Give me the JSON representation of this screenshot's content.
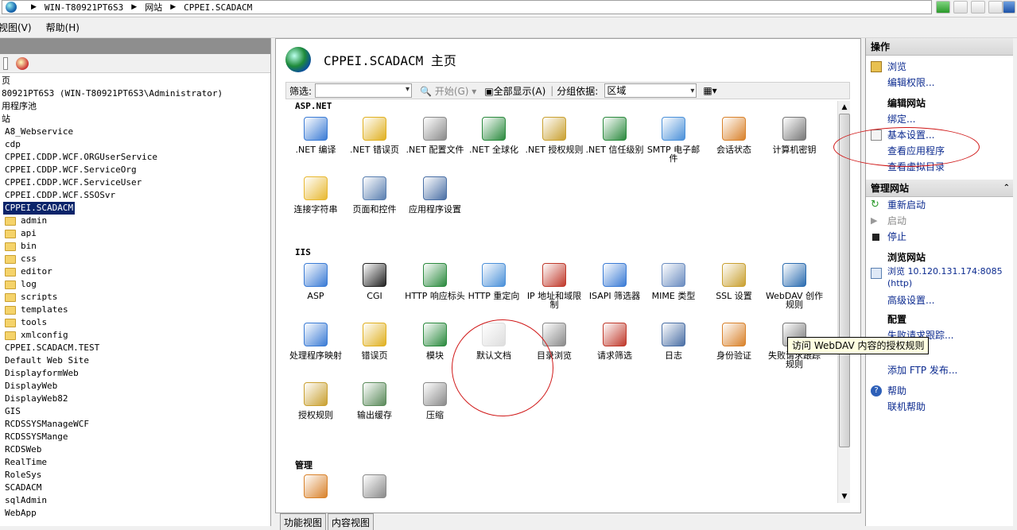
{
  "address": {
    "crumbs": [
      "WIN-T80921PT6S3",
      "网站",
      "CPPEI.SCADACM"
    ]
  },
  "menu": {
    "view": "视图(V)",
    "help": "帮助(H)"
  },
  "tree": {
    "items": [
      {
        "label": "页",
        "level": 0
      },
      {
        "label": "80921PT6S3 (WIN-T80921PT6S3\\Administrator)",
        "level": 0
      },
      {
        "label": "用程序池",
        "level": 0
      },
      {
        "label": "站",
        "level": 0
      },
      {
        "label": "A8_Webservice",
        "level": 1
      },
      {
        "label": "cdp",
        "level": 1
      },
      {
        "label": "CPPEI.CDDP.WCF.ORGUserService",
        "level": 1
      },
      {
        "label": "CPPEI.CDDP.WCF.ServiceOrg",
        "level": 1
      },
      {
        "label": "CPPEI.CDDP.WCF.ServiceUser",
        "level": 1
      },
      {
        "label": "CPPEI.CDDP.WCF.SSOSvr",
        "level": 1
      },
      {
        "label": "CPPEI.SCADACM",
        "level": 1,
        "selected": true
      },
      {
        "label": "admin",
        "level": 2
      },
      {
        "label": "api",
        "level": 2
      },
      {
        "label": "bin",
        "level": 2
      },
      {
        "label": "css",
        "level": 2
      },
      {
        "label": "editor",
        "level": 2
      },
      {
        "label": "log",
        "level": 2
      },
      {
        "label": "scripts",
        "level": 2
      },
      {
        "label": "templates",
        "level": 2
      },
      {
        "label": "tools",
        "level": 2
      },
      {
        "label": "xmlconfig",
        "level": 2
      },
      {
        "label": "CPPEI.SCADACM.TEST",
        "level": 1
      },
      {
        "label": "Default Web Site",
        "level": 1
      },
      {
        "label": "DisplayformWeb",
        "level": 1
      },
      {
        "label": "DisplayWeb",
        "level": 1
      },
      {
        "label": "DisplayWeb82",
        "level": 1
      },
      {
        "label": "GIS",
        "level": 1
      },
      {
        "label": "RCDSSYSManageWCF",
        "level": 1
      },
      {
        "label": "RCDSSYSMange",
        "level": 1
      },
      {
        "label": "RCDSWeb",
        "level": 1
      },
      {
        "label": "RealTime",
        "level": 1
      },
      {
        "label": "RoleSys",
        "level": 1
      },
      {
        "label": "SCADACM",
        "level": 1
      },
      {
        "label": "sqlAdmin",
        "level": 1
      },
      {
        "label": "WebApp",
        "level": 1
      }
    ]
  },
  "center": {
    "title": "CPPEI.SCADACM 主页",
    "filter_label": "筛选:",
    "start_label": "开始(G)",
    "show_all_label": "全部显示(A)",
    "group_by_label": "分组依据:",
    "group_by_value": "区域",
    "groups": [
      {
        "name": "ASP.NET",
        "features": [
          {
            "label": ".NET 编译",
            "color": "#3a7bd5"
          },
          {
            "label": ".NET 错误页",
            "color": "#e0b020"
          },
          {
            "label": ".NET 配置文件",
            "color": "#8a8a8a"
          },
          {
            "label": ".NET 全球化",
            "color": "#2b8a3e"
          },
          {
            "label": ".NET 授权规则",
            "color": "#c9a030"
          },
          {
            "label": ".NET 信任级别",
            "color": "#2b8a3e"
          },
          {
            "label": "SMTP 电子邮件",
            "color": "#4a90d9"
          },
          {
            "label": "会话状态",
            "color": "#d9822b"
          },
          {
            "label": "计算机密钥",
            "color": "#777777"
          },
          {
            "label": "连接字符串",
            "color": "#e8b830"
          },
          {
            "label": "页面和控件",
            "color": "#5a7fb0"
          },
          {
            "label": "应用程序设置",
            "color": "#4a6fa5"
          }
        ]
      },
      {
        "name": "IIS",
        "features": [
          {
            "label": "ASP",
            "color": "#3a7bd5"
          },
          {
            "label": "CGI",
            "color": "#222222"
          },
          {
            "label": "HTTP 响应标头",
            "color": "#2b8a3e"
          },
          {
            "label": "HTTP 重定向",
            "color": "#4a90d9"
          },
          {
            "label": "IP 地址和域限制",
            "color": "#c0392b"
          },
          {
            "label": "ISAPI 筛选器",
            "color": "#3a7bd5"
          },
          {
            "label": "MIME 类型",
            "color": "#6a8cc0"
          },
          {
            "label": "SSL 设置",
            "color": "#c9a030"
          },
          {
            "label": "WebDAV 创作规则",
            "color": "#2b6cb0"
          },
          {
            "label": "处理程序映射",
            "color": "#3a7bd5"
          },
          {
            "label": "错误页",
            "color": "#e0b020"
          },
          {
            "label": "模块",
            "color": "#2b8a3e"
          },
          {
            "label": "默认文档",
            "color": "#dddddd"
          },
          {
            "label": "目录浏览",
            "color": "#8a8a8a"
          },
          {
            "label": "请求筛选",
            "color": "#c0392b"
          },
          {
            "label": "日志",
            "color": "#4a6fa5"
          },
          {
            "label": "身份验证",
            "color": "#d9822b"
          },
          {
            "label": "失败请求跟踪规则",
            "color": "#777777"
          },
          {
            "label": "授权规则",
            "color": "#c9a030"
          },
          {
            "label": "输出缓存",
            "color": "#5a8a5a"
          },
          {
            "label": "压缩",
            "color": "#8a8a8a"
          }
        ]
      },
      {
        "name": "管理",
        "features": [
          {
            "label": "",
            "color": "#d9822b"
          },
          {
            "label": "",
            "color": "#8a8a8a"
          }
        ]
      }
    ],
    "tabs": [
      "功能视图",
      "内容视图"
    ]
  },
  "actions": {
    "header": "操作",
    "browse": "浏览",
    "edit_perms": "编辑权限...",
    "edit_site_header": "编辑网站",
    "bindings": "绑定...",
    "basic_settings": "基本设置...",
    "view_apps": "查看应用程序",
    "view_vdirs": "查看虚拟目录",
    "manage_header": "管理网站",
    "restart": "重新启动",
    "start": "启动",
    "stop": "停止",
    "browse_site_header": "浏览网站",
    "browse_url_1": "浏览 10.120.131.174:8085",
    "browse_url_2": "(http)",
    "advanced": "高级设置...",
    "config_header": "配置",
    "failed_req": "失败请求跟踪...",
    "add_ftp": "添加 FTP 发布...",
    "help": "帮助",
    "online_help": "联机帮助"
  },
  "tooltip": "访问 WebDAV 内容的授权规则"
}
